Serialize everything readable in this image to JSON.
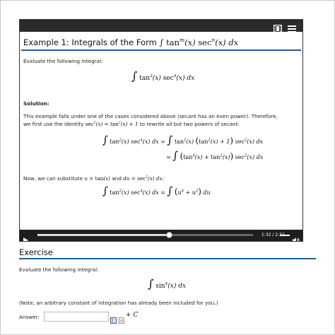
{
  "player": {
    "example_title_prefix": "Example 1: Integrals of the Form",
    "prompt": "Evaluate the following integral:",
    "solution_label": "Solution:",
    "solution_line1": "This example falls under one of the cases considered above (secant has an even power). Therefore,",
    "solution_line2_a": "we first use the identity",
    "solution_line2_b": "to rewrite all but two powers of secant:",
    "substitute_a": "Now, we can substitute",
    "substitute_b": "and",
    "time": "1:32 / 2:32",
    "progress": 0.61
  },
  "exercise": {
    "heading": "Exercise",
    "prompt": "Evaluate the following integral:",
    "note": "(Note, an arbitrary constant of integration has already been included for you.)",
    "answer_label": "Answer:",
    "plus_c": "+ C"
  },
  "icons": {
    "film": "film-icon",
    "menu": "menu-icon",
    "play": "play-icon",
    "volume": "volume-icon",
    "keyboard": "keyboard-icon",
    "document": "document-icon"
  },
  "colors": {
    "accent": "#1f5f99",
    "player_bar": "#2b2b2b"
  }
}
